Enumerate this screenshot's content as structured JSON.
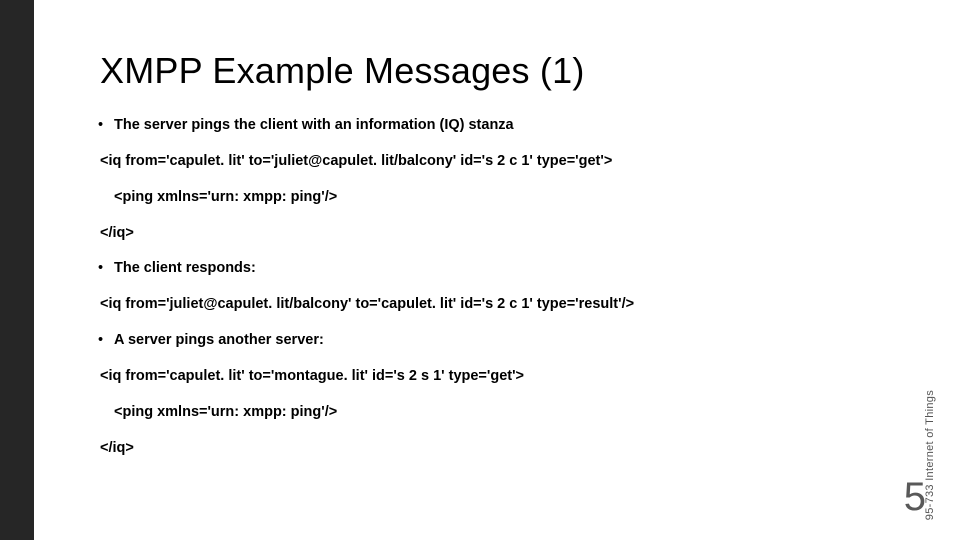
{
  "slide": {
    "title": "XMPP Example Messages (1)",
    "lines": {
      "l1": "The server pings the client with an information (IQ) stanza",
      "l2": "<iq from='capulet. lit' to='juliet@capulet. lit/balcony' id='s 2 c 1' type='get'>",
      "l3": "<ping xmlns='urn: xmpp: ping'/>",
      "l4": "</iq>",
      "l5": "The client responds:",
      "l6": "<iq from='juliet@capulet. lit/balcony' to='capulet. lit' id='s 2 c 1' type='result'/>",
      "l7": "A server pings another server:",
      "l8": "<iq from='capulet. lit' to='montague. lit' id='s 2 s 1' type='get'>",
      "l9": "<ping xmlns='urn: xmpp: ping'/>",
      "l10": "</iq>"
    },
    "side_label": "95-733 Internet of Things",
    "page_number": "5"
  }
}
